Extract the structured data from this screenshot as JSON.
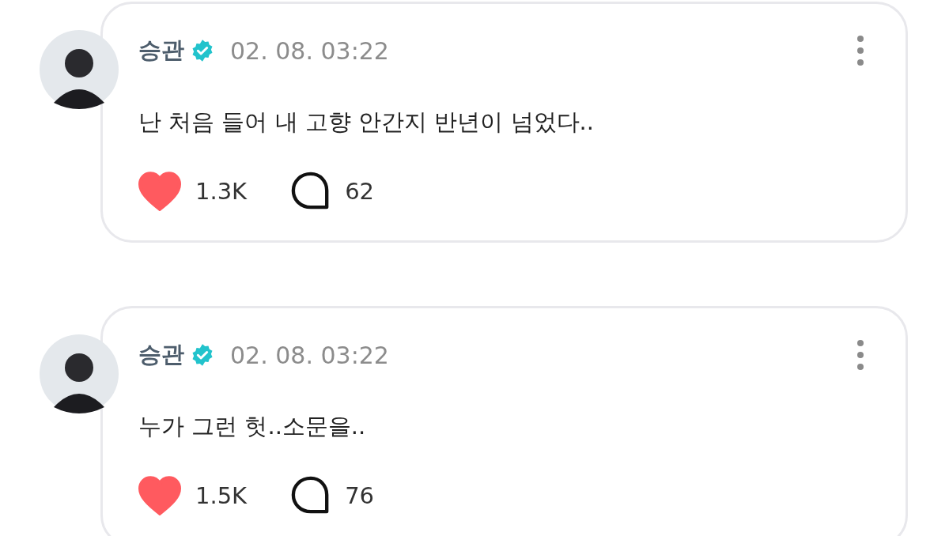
{
  "posts": [
    {
      "author": "승관",
      "verified": true,
      "time": "02. 08. 03:22",
      "text": "난 처음 들어 내 고향 안간지 반년이 넘었다..",
      "liked": true,
      "likes": "1.3K",
      "comments": "62"
    },
    {
      "author": "승관",
      "verified": true,
      "time": "02. 08. 03:22",
      "text": "누가 그런 헛..소문을..",
      "liked": true,
      "likes": "1.5K",
      "comments": "76"
    }
  ]
}
